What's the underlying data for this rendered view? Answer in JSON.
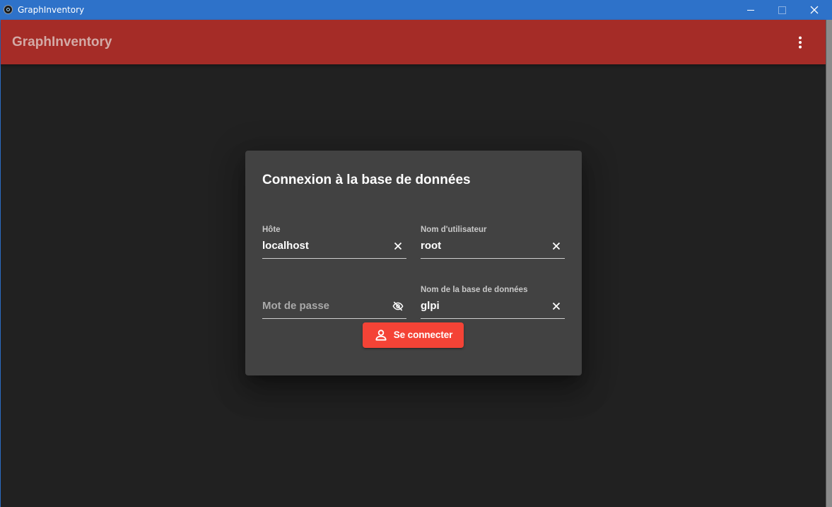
{
  "window": {
    "title": "GraphInventory"
  },
  "appbar": {
    "title": "GraphInventory",
    "menu_icon": "more-vert-icon"
  },
  "dialog": {
    "title": "Connexion à la base de données",
    "fields": {
      "host": {
        "label": "Hôte",
        "value": "localhost",
        "icon": "clear-icon"
      },
      "user": {
        "label": "Nom d'utilisateur",
        "value": "root",
        "icon": "clear-icon"
      },
      "password": {
        "placeholder": "Mot de passe",
        "value": "",
        "icon": "visibility-off-icon"
      },
      "database": {
        "label": "Nom de la base de données",
        "value": "glpi",
        "icon": "clear-icon"
      }
    },
    "connect_button": {
      "label": "Se connecter",
      "icon": "person-outline-icon"
    }
  },
  "colors": {
    "appbar": "#a52c27",
    "background": "#212121",
    "dialog": "#424242",
    "button": "#f44336",
    "titlebar": "#2e72c9"
  }
}
